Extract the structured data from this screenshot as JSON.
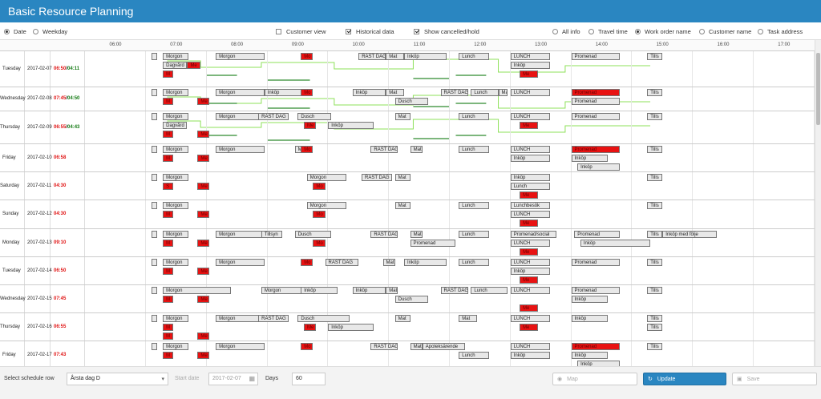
{
  "app": {
    "title": "Basic Resource Planning"
  },
  "options": {
    "date": "Date",
    "weekday": "Weekday",
    "customer_view": "Customer view",
    "historical_data": "Historical data",
    "show_cancelled": "Show cancelled/hold",
    "all_info": "All info",
    "travel_time": "Travel time",
    "work_order_name": "Work order name",
    "customer_name": "Customer name",
    "task_address": "Task address"
  },
  "hours": [
    "06:00",
    "07:00",
    "08:00",
    "09:00",
    "10:00",
    "11:00",
    "12:00",
    "13:00",
    "14:00",
    "15:00",
    "16:00",
    "17:00"
  ],
  "rows": [
    {
      "weekday": "Tuesday",
      "date": "2017-02-07",
      "start": "06:50",
      "end": "04:11"
    },
    {
      "weekday": "Wednesday",
      "date": "2017-02-08",
      "start": "07:45",
      "end": "04:50"
    },
    {
      "weekday": "Thursday",
      "date": "2017-02-09",
      "start": "06:55",
      "end": "04:43"
    },
    {
      "weekday": "Friday",
      "date": "2017-02-10",
      "start": "06:58",
      "end": ""
    },
    {
      "weekday": "Saturday",
      "date": "2017-02-11",
      "start": "04:30",
      "end": ""
    },
    {
      "weekday": "Sunday",
      "date": "2017-02-12",
      "start": "04:30",
      "end": ""
    },
    {
      "weekday": "Monday",
      "date": "2017-02-13",
      "start": "09:10",
      "end": ""
    },
    {
      "weekday": "Tuesday",
      "date": "2017-02-14",
      "start": "06:50",
      "end": ""
    },
    {
      "weekday": "Wednesday",
      "date": "2017-02-15",
      "start": "07:45",
      "end": ""
    },
    {
      "weekday": "Thursday",
      "date": "2017-02-16",
      "start": "06:55",
      "end": ""
    },
    {
      "weekday": "Friday",
      "date": "2017-02-17",
      "start": "07:43",
      "end": ""
    },
    {
      "weekday": "",
      "date": "",
      "start": "",
      "end": ""
    }
  ],
  "tasks": [
    [
      [
        "",
        6.6,
        6.68,
        0,
        "g"
      ],
      [
        "Morgon",
        6.78,
        7.2,
        0,
        "g"
      ],
      [
        "Morgon",
        7.65,
        8.45,
        0,
        "g"
      ],
      [
        "Mo",
        9.05,
        9.25,
        0,
        "r"
      ],
      [
        "RAST DAG",
        10.0,
        10.45,
        0,
        "g"
      ],
      [
        "Mat",
        10.45,
        10.75,
        0,
        "g"
      ],
      [
        "Inköp",
        10.75,
        11.45,
        0,
        "g"
      ],
      [
        "Lunch",
        11.65,
        12.15,
        0,
        "g"
      ],
      [
        "LUNCH",
        12.5,
        13.15,
        0,
        "g"
      ],
      [
        "Promenad",
        13.5,
        14.3,
        0,
        "g"
      ],
      [
        "Tills",
        14.75,
        15.0,
        0,
        "g"
      ],
      [
        "Dagvård",
        6.78,
        7.18,
        1,
        "g"
      ],
      [
        "Me",
        7.18,
        7.4,
        1,
        "r"
      ],
      [
        "Inköp",
        12.5,
        13.15,
        1,
        "g"
      ],
      [
        "M",
        6.78,
        6.95,
        2,
        "r"
      ],
      [
        "Me",
        12.65,
        12.95,
        2,
        "r"
      ]
    ],
    [
      [
        "",
        6.6,
        6.68,
        0,
        "g"
      ],
      [
        "Morgon",
        6.78,
        7.2,
        0,
        "g"
      ],
      [
        "Morgon",
        7.65,
        8.45,
        0,
        "g"
      ],
      [
        "Inköp",
        8.45,
        9.25,
        0,
        "g"
      ],
      [
        "Mo",
        9.05,
        9.25,
        0,
        "r"
      ],
      [
        "Inköp",
        9.9,
        10.45,
        0,
        "g"
      ],
      [
        "Mat",
        10.45,
        10.75,
        0,
        "g"
      ],
      [
        "RAST DAG",
        11.35,
        11.8,
        0,
        "g"
      ],
      [
        "Lunch",
        11.85,
        12.3,
        0,
        "g"
      ],
      [
        "Mat",
        12.3,
        12.45,
        0,
        "g"
      ],
      [
        "LUNCH",
        12.5,
        13.15,
        0,
        "g"
      ],
      [
        "Promenad",
        13.5,
        14.3,
        0,
        "r"
      ],
      [
        "Tills",
        14.75,
        15.0,
        0,
        "g"
      ],
      [
        "M",
        6.78,
        6.95,
        1,
        "r"
      ],
      [
        "Me",
        7.35,
        7.55,
        1,
        "r"
      ],
      [
        "Dusch",
        10.6,
        11.15,
        1,
        "g"
      ],
      [
        "Promenad",
        13.5,
        14.3,
        1,
        "g"
      ]
    ],
    [
      [
        "",
        6.6,
        6.68,
        0,
        "g"
      ],
      [
        "Morgon",
        6.78,
        7.2,
        0,
        "g"
      ],
      [
        "Morgon",
        7.65,
        8.45,
        0,
        "g"
      ],
      [
        "RAST DAG",
        8.35,
        8.85,
        0,
        "g"
      ],
      [
        "Dusch",
        9.0,
        9.55,
        0,
        "g"
      ],
      [
        "Mat",
        10.6,
        10.85,
        0,
        "g"
      ],
      [
        "Lunch",
        11.65,
        12.15,
        0,
        "g"
      ],
      [
        "LUNCH",
        12.5,
        13.15,
        0,
        "g"
      ],
      [
        "Promenad",
        13.5,
        14.3,
        0,
        "g"
      ],
      [
        "Tills",
        14.75,
        15.0,
        0,
        "g"
      ],
      [
        "Dagvård",
        6.78,
        7.18,
        1,
        "g"
      ],
      [
        "Me",
        9.1,
        9.3,
        1,
        "r"
      ],
      [
        "Inköp",
        9.5,
        10.25,
        1,
        "g"
      ],
      [
        "Me",
        12.65,
        12.95,
        1,
        "r"
      ],
      [
        "M",
        6.78,
        6.95,
        2,
        "r"
      ],
      [
        "Me",
        7.35,
        7.55,
        2,
        "r"
      ]
    ],
    [
      [
        "",
        6.6,
        6.68,
        0,
        "g"
      ],
      [
        "Morgon",
        6.78,
        7.2,
        0,
        "g"
      ],
      [
        "Morgon",
        7.65,
        8.45,
        0,
        "g"
      ],
      [
        "Mo",
        8.95,
        9.15,
        0,
        "g"
      ],
      [
        "Mo",
        9.05,
        9.25,
        0,
        "r"
      ],
      [
        "RAST DAG",
        10.2,
        10.65,
        0,
        "g"
      ],
      [
        "Mat",
        10.85,
        11.05,
        0,
        "g"
      ],
      [
        "Lunch",
        11.65,
        12.15,
        0,
        "g"
      ],
      [
        "LUNCH",
        12.5,
        13.15,
        0,
        "g"
      ],
      [
        "Promenad",
        13.5,
        14.3,
        0,
        "r"
      ],
      [
        "Tills",
        14.75,
        15.0,
        0,
        "g"
      ],
      [
        "M",
        6.78,
        6.95,
        1,
        "r"
      ],
      [
        "Me",
        7.35,
        7.55,
        1,
        "r"
      ],
      [
        "Inköp",
        12.5,
        13.15,
        1,
        "g"
      ],
      [
        "Inköp",
        13.5,
        14.1,
        1,
        "g"
      ],
      [
        "Inköp",
        13.6,
        14.3,
        2,
        "g"
      ]
    ],
    [
      [
        "",
        6.6,
        6.68,
        0,
        "g"
      ],
      [
        "Morgon",
        6.78,
        7.2,
        0,
        "g"
      ],
      [
        "Morgon",
        9.15,
        9.8,
        0,
        "g"
      ],
      [
        "RAST DAG",
        10.05,
        10.55,
        0,
        "g"
      ],
      [
        "Mat",
        10.6,
        10.85,
        0,
        "g"
      ],
      [
        "Inköp",
        12.5,
        13.15,
        0,
        "g"
      ],
      [
        "Tills",
        14.75,
        15.0,
        0,
        "g"
      ],
      [
        "S",
        6.78,
        6.95,
        1,
        "r"
      ],
      [
        "Me",
        7.35,
        7.55,
        1,
        "r"
      ],
      [
        "Mo",
        9.25,
        9.45,
        1,
        "r"
      ],
      [
        "Lunch",
        12.5,
        13.15,
        1,
        "g"
      ],
      [
        "Me",
        12.65,
        12.95,
        2,
        "r"
      ]
    ],
    [
      [
        "",
        6.6,
        6.68,
        0,
        "g"
      ],
      [
        "Morgon",
        6.78,
        7.2,
        0,
        "g"
      ],
      [
        "Morgon",
        9.15,
        9.8,
        0,
        "g"
      ],
      [
        "Mat",
        10.6,
        10.85,
        0,
        "g"
      ],
      [
        "Lunch",
        11.65,
        12.15,
        0,
        "g"
      ],
      [
        "Lunchbesök",
        12.5,
        13.15,
        0,
        "g"
      ],
      [
        "Tills",
        14.75,
        15.0,
        0,
        "g"
      ],
      [
        "M",
        6.78,
        6.95,
        1,
        "r"
      ],
      [
        "Me",
        7.35,
        7.55,
        1,
        "r"
      ],
      [
        "Mo",
        9.25,
        9.45,
        1,
        "r"
      ],
      [
        "LUNCH",
        12.5,
        13.15,
        1,
        "g"
      ],
      [
        "Me",
        12.65,
        12.95,
        2,
        "r"
      ]
    ],
    [
      [
        "",
        6.6,
        6.68,
        0,
        "g"
      ],
      [
        "Morgon",
        6.78,
        7.2,
        0,
        "g"
      ],
      [
        "Morgon",
        7.65,
        8.45,
        0,
        "g"
      ],
      [
        "Tillsyn",
        8.4,
        8.75,
        0,
        "g"
      ],
      [
        "Dusch",
        8.95,
        9.55,
        0,
        "g"
      ],
      [
        "RAST DAG",
        10.2,
        10.65,
        0,
        "g"
      ],
      [
        "Mat",
        10.85,
        11.05,
        0,
        "g"
      ],
      [
        "Lunch",
        11.65,
        12.15,
        0,
        "g"
      ],
      [
        "Promenad/social",
        12.5,
        13.25,
        0,
        "g"
      ],
      [
        "Promenad",
        13.55,
        14.3,
        0,
        "g"
      ],
      [
        "Tills",
        14.75,
        15.0,
        0,
        "g"
      ],
      [
        "Inköp med följe",
        15.0,
        15.9,
        0,
        "g"
      ],
      [
        "M",
        6.78,
        6.95,
        1,
        "r"
      ],
      [
        "Me",
        7.35,
        7.55,
        1,
        "r"
      ],
      [
        "Mo",
        9.25,
        9.45,
        1,
        "r"
      ],
      [
        "Promenad",
        10.85,
        11.6,
        1,
        "g"
      ],
      [
        "LUNCH",
        12.5,
        13.15,
        1,
        "g"
      ],
      [
        "Inköp",
        13.65,
        14.8,
        1,
        "g"
      ],
      [
        "Me",
        12.65,
        12.95,
        2,
        "r"
      ]
    ],
    [
      [
        "",
        6.6,
        6.68,
        0,
        "g"
      ],
      [
        "Morgon",
        6.78,
        7.2,
        0,
        "g"
      ],
      [
        "Morgon",
        7.65,
        8.45,
        0,
        "g"
      ],
      [
        "Mo",
        9.05,
        9.25,
        0,
        "r"
      ],
      [
        "RAST DAG",
        9.45,
        10.0,
        0,
        "g"
      ],
      [
        "Mat",
        10.4,
        10.6,
        0,
        "g"
      ],
      [
        "Inköp",
        10.75,
        11.45,
        0,
        "g"
      ],
      [
        "Lunch",
        11.65,
        12.15,
        0,
        "g"
      ],
      [
        "LUNCH",
        12.5,
        13.15,
        0,
        "g"
      ],
      [
        "Promenad",
        13.5,
        14.3,
        0,
        "g"
      ],
      [
        "Tills",
        14.75,
        15.0,
        0,
        "g"
      ],
      [
        "M",
        6.78,
        6.95,
        1,
        "r"
      ],
      [
        "Me",
        7.35,
        7.55,
        1,
        "r"
      ],
      [
        "Inköp",
        12.5,
        13.15,
        1,
        "g"
      ],
      [
        "Me",
        12.65,
        12.95,
        2,
        "r"
      ]
    ],
    [
      [
        "",
        6.6,
        6.68,
        0,
        "g"
      ],
      [
        "Morgon",
        6.78,
        7.9,
        0,
        "g"
      ],
      [
        "Morgon",
        8.4,
        9.15,
        0,
        "g"
      ],
      [
        "Inköp",
        9.05,
        9.65,
        0,
        "g"
      ],
      [
        "Inköp",
        9.9,
        10.45,
        0,
        "g"
      ],
      [
        "Mat",
        10.45,
        10.65,
        0,
        "g"
      ],
      [
        "RAST DAG",
        11.35,
        11.8,
        0,
        "g"
      ],
      [
        "Lunch",
        11.85,
        12.45,
        0,
        "g"
      ],
      [
        "LUNCH",
        12.5,
        13.15,
        0,
        "g"
      ],
      [
        "Promenad",
        13.5,
        14.3,
        0,
        "g"
      ],
      [
        "Tills",
        14.75,
        15.0,
        0,
        "g"
      ],
      [
        "M",
        6.78,
        6.95,
        1,
        "r"
      ],
      [
        "Me",
        7.35,
        7.55,
        1,
        "r"
      ],
      [
        "Dusch",
        10.6,
        11.15,
        1,
        "g"
      ],
      [
        "Inköp",
        13.5,
        14.1,
        1,
        "g"
      ],
      [
        "Me",
        12.65,
        12.95,
        2,
        "r"
      ]
    ],
    [
      [
        "",
        6.6,
        6.68,
        0,
        "g"
      ],
      [
        "Morgon",
        6.78,
        7.2,
        0,
        "g"
      ],
      [
        "Morgon",
        7.65,
        8.45,
        0,
        "g"
      ],
      [
        "RAST DAG",
        8.35,
        8.85,
        0,
        "g"
      ],
      [
        "Dusch",
        9.0,
        9.85,
        0,
        "g"
      ],
      [
        "Mat",
        10.6,
        10.85,
        0,
        "g"
      ],
      [
        "Mat",
        11.65,
        11.95,
        0,
        "g"
      ],
      [
        "LUNCH",
        12.5,
        13.15,
        0,
        "g"
      ],
      [
        "Inköp",
        13.5,
        14.1,
        0,
        "g"
      ],
      [
        "Tills",
        14.75,
        15.0,
        0,
        "g"
      ],
      [
        "M",
        6.78,
        6.95,
        1,
        "r"
      ],
      [
        "Me",
        9.1,
        9.3,
        1,
        "r"
      ],
      [
        "Inköp",
        9.5,
        10.25,
        1,
        "g"
      ],
      [
        "Me",
        12.65,
        12.95,
        1,
        "r"
      ],
      [
        "Tills",
        14.75,
        15.0,
        1,
        "g"
      ],
      [
        "M",
        6.78,
        6.95,
        2,
        "r"
      ],
      [
        "Me",
        7.35,
        7.55,
        2,
        "r"
      ]
    ],
    [
      [
        "",
        6.6,
        6.68,
        0,
        "g"
      ],
      [
        "Morgon",
        6.78,
        7.2,
        0,
        "g"
      ],
      [
        "Morgon",
        7.65,
        8.45,
        0,
        "g"
      ],
      [
        "Mo",
        9.05,
        9.25,
        0,
        "r"
      ],
      [
        "RAST DAG",
        10.2,
        10.65,
        0,
        "g"
      ],
      [
        "Mat",
        10.85,
        11.05,
        0,
        "g"
      ],
      [
        "Apoteksärende",
        11.05,
        11.75,
        0,
        "g"
      ],
      [
        "LUNCH",
        12.5,
        13.15,
        0,
        "g"
      ],
      [
        "Promenad",
        13.5,
        14.3,
        0,
        "r"
      ],
      [
        "Tills",
        14.75,
        15.0,
        0,
        "g"
      ],
      [
        "M",
        6.78,
        6.95,
        1,
        "r"
      ],
      [
        "Me",
        7.35,
        7.55,
        1,
        "r"
      ],
      [
        "Lunch",
        11.65,
        12.15,
        1,
        "g"
      ],
      [
        "Inköp",
        12.5,
        13.15,
        1,
        "g"
      ],
      [
        "Inköp",
        13.5,
        14.1,
        1,
        "g"
      ],
      [
        "Inköp",
        13.6,
        14.3,
        2,
        "g"
      ]
    ],
    [
      [
        "Morgon",
        6.78,
        7.2,
        0,
        "g"
      ],
      [
        "Morgon",
        9.15,
        9.8,
        0,
        "g"
      ],
      [
        "Lunchbesök",
        12.5,
        13.15,
        0,
        "g"
      ]
    ]
  ],
  "bottom": {
    "schedule_row_label": "Select schedule row",
    "schedule_row_value": "Årsta dag D",
    "start_date_label": "Start date",
    "start_date_value": "2017-02-07",
    "days_label": "Days",
    "days_value": "60",
    "map_label": "Map",
    "update_label": "Update",
    "save_label": "Save"
  }
}
